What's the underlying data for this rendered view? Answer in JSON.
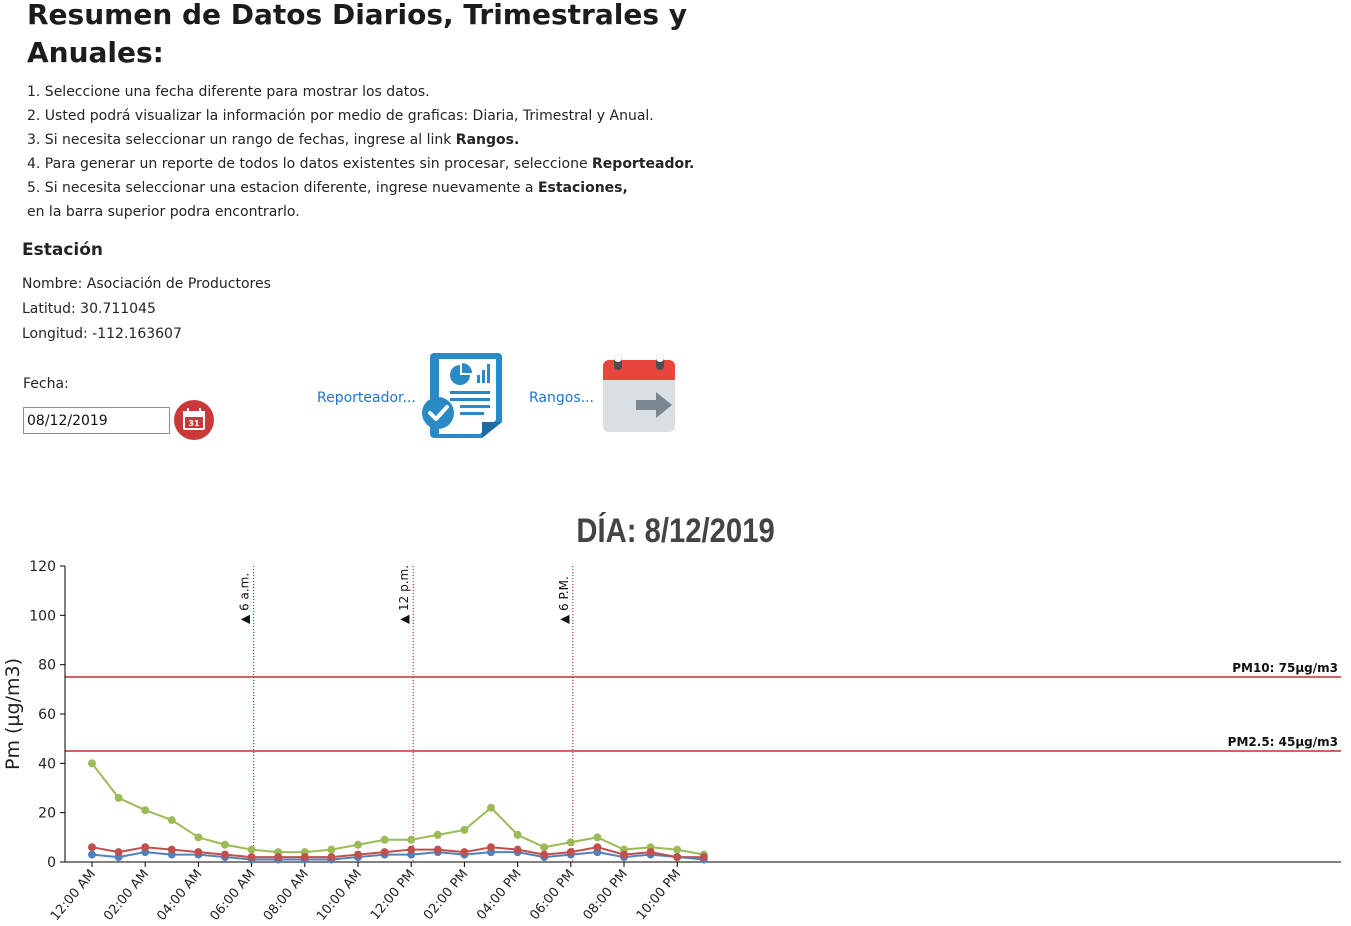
{
  "page": {
    "title": "Resumen de Datos Diarios, Trimestrales y Anuales:",
    "instructions": [
      {
        "pre": "1. Seleccione una fecha diferente para mostrar los datos.",
        "bold": "",
        "post": ""
      },
      {
        "pre": "2. Usted podrá visualizar la información por medio de graficas: Diaria, Trimestral y Anual.",
        "bold": "",
        "post": ""
      },
      {
        "pre": "3. Si necesita seleccionar un rango de fechas, ingrese al link ",
        "bold": "Rangos.",
        "post": ""
      },
      {
        "pre": "4. Para generar un reporte de todos lo datos existentes sin procesar, seleccione ",
        "bold": "Reporteador.",
        "post": ""
      },
      {
        "pre": "5. Si necesita seleccionar una estacion diferente, ingrese nuevamente a ",
        "bold": "Estaciones,",
        "post": ""
      },
      {
        "pre": "en la barra superior podra encontrarlo.",
        "bold": "",
        "post": ""
      }
    ]
  },
  "station": {
    "title": "Estación",
    "name": "Nombre: Asociación de Productores",
    "latitude": "Latitud: 30.711045",
    "longitude": "Longitud: -112.163607"
  },
  "date": {
    "label": "Fecha:",
    "value": "08/12/2019",
    "calendar_day": "31"
  },
  "links": {
    "report": "Reporteador...",
    "ranges": "Rangos..."
  },
  "icons": {
    "calendar_button": "calendar-icon",
    "report": "report-document-icon",
    "ranges": "calendar-arrow-icon"
  },
  "colors": {
    "link": "#1a75d2",
    "calendar_button": "#c9393b",
    "threshold": "#c00000",
    "series_blue": "#4f81bd",
    "series_red": "#c0504d",
    "series_green": "#9bbb59"
  },
  "chart_data": {
    "type": "line",
    "title": "DÍA: 8/12/2019",
    "ylabel": "Pm (µg/m3)",
    "xlabel": "",
    "ylim": [
      0,
      120
    ],
    "yticks": [
      0,
      20,
      40,
      60,
      80,
      100,
      120
    ],
    "x": [
      "12:00 AM",
      "01:00 AM",
      "02:00 AM",
      "03:00 AM",
      "04:00 AM",
      "05:00 AM",
      "06:00 AM",
      "07:00 AM",
      "08:00 AM",
      "09:00 AM",
      "10:00 AM",
      "11:00 AM",
      "12:00 PM",
      "01:00 PM",
      "02:00 PM",
      "03:00 PM",
      "04:00 PM",
      "05:00 PM",
      "06:00 PM",
      "07:00 PM",
      "08:00 PM",
      "09:00 PM",
      "10:00 PM",
      "11:00 PM"
    ],
    "xtick_labels": [
      "12:00 AM",
      "02:00 AM",
      "04:00 AM",
      "06:00 AM",
      "08:00 AM",
      "10:00 AM",
      "12:00 PM",
      "02:00 PM",
      "04:00 PM",
      "06:00 PM",
      "08:00 PM",
      "10:00 PM"
    ],
    "series": [
      {
        "color": "#4f81bd",
        "values": [
          3,
          2,
          4,
          3,
          3,
          2,
          1,
          1,
          1,
          1,
          2,
          3,
          3,
          4,
          3,
          4,
          4,
          2,
          3,
          4,
          2,
          3,
          2,
          1
        ]
      },
      {
        "color": "#c0504d",
        "values": [
          6,
          4,
          6,
          5,
          4,
          3,
          2,
          2,
          2,
          2,
          3,
          4,
          5,
          5,
          4,
          6,
          5,
          3,
          4,
          6,
          3,
          4,
          2,
          2
        ]
      },
      {
        "color": "#9bbb59",
        "values": [
          40,
          26,
          21,
          17,
          10,
          7,
          5,
          4,
          4,
          5,
          7,
          9,
          9,
          11,
          13,
          22,
          11,
          6,
          8,
          10,
          5,
          6,
          5,
          3
        ]
      }
    ],
    "thresholds": [
      {
        "label": "PM10: 75µg/m3",
        "value": 75
      },
      {
        "label": "PM2.5: 45µg/m3",
        "value": 45
      }
    ],
    "markers": [
      {
        "label": "▲ 6 a.m.",
        "x": "06:00 AM"
      },
      {
        "label": "▲ 12 p.m.",
        "x": "12:00 PM"
      },
      {
        "label": "▲ 6 P.M.",
        "x": "06:00 PM"
      }
    ],
    "grid": false,
    "legend": "none"
  }
}
